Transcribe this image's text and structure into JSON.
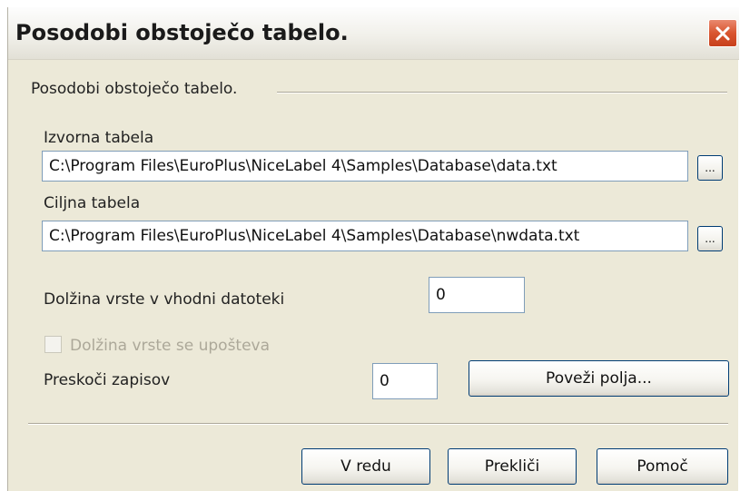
{
  "dialog": {
    "title": "Posodobi obstoječo tabelo.",
    "close_icon": "close-x-icon",
    "group_label": "Posodobi obstoječo tabelo."
  },
  "source_table": {
    "label": "Izvorna tabela",
    "value": "C:\\Program Files\\EuroPlus\\NiceLabel 4\\Samples\\Database\\data.txt",
    "browse_label": "..."
  },
  "target_table": {
    "label": "Ciljna tabela",
    "value": "C:\\Program Files\\EuroPlus\\NiceLabel 4\\Samples\\Database\\nwdata.txt",
    "browse_label": "..."
  },
  "line_length": {
    "label": "Dolžina vrste v vhodni datoteki",
    "value": "0"
  },
  "line_length_respected": {
    "label": "Dolžina vrste se upošteva",
    "checked": false,
    "enabled": false
  },
  "skip_records": {
    "label": "Preskoči zapisov",
    "value": "0"
  },
  "buttons": {
    "map_fields": "Poveži polja...",
    "ok": "V redu",
    "cancel": "Prekliči",
    "help": "Pomoč"
  },
  "colors": {
    "dialog_bg": "#ece9d8",
    "close_button": "#d9552f",
    "button_border": "#003c74",
    "textbox_border": "#7f9db9",
    "disabled_text": "#aca899"
  }
}
